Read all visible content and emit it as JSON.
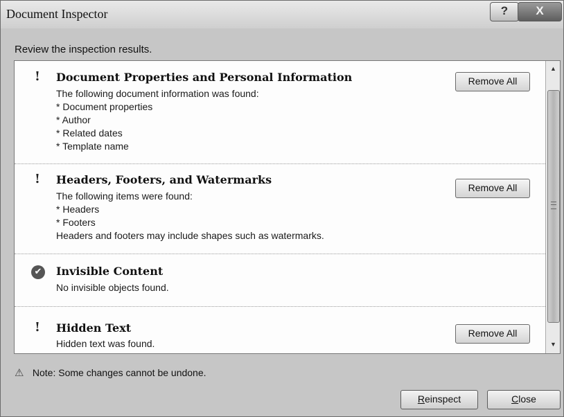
{
  "window": {
    "title": "Document Inspector",
    "help_label": "?",
    "close_label": "X"
  },
  "review_label": "Review the inspection results.",
  "sections": [
    {
      "status": "warning",
      "title": "Document Properties and Personal Information",
      "lines": [
        "The following document information was found:",
        "* Document properties",
        "* Author",
        "* Related dates",
        "* Template name"
      ],
      "button": "Remove All"
    },
    {
      "status": "warning",
      "title": "Headers, Footers, and Watermarks",
      "lines": [
        "The following items were found:",
        "* Headers",
        "* Footers",
        "Headers and footers may include shapes such as watermarks."
      ],
      "button": "Remove All"
    },
    {
      "status": "ok",
      "title": "Invisible Content",
      "lines": [
        "No invisible objects found."
      ],
      "button": ""
    },
    {
      "status": "warning",
      "title": "Hidden Text",
      "lines": [
        "Hidden text was found."
      ],
      "button": "Remove All"
    }
  ],
  "icons": {
    "warning": "!",
    "ok": "✔",
    "note": "⚠",
    "scroll_up": "▲",
    "scroll_down": "▼"
  },
  "note": "Note: Some changes cannot be undone.",
  "footer": {
    "reinspect_mnemonic": "R",
    "reinspect_rest": "einspect",
    "close_mnemonic": "C",
    "close_rest": "lose"
  }
}
